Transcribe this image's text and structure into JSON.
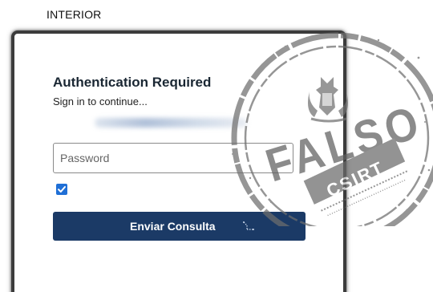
{
  "header": {
    "label": "INTERIOR"
  },
  "dialog": {
    "title": "Authentication Required",
    "subtitle": "Sign in to continue..."
  },
  "form": {
    "password_placeholder": "Password",
    "password_value": "",
    "remember_checked": true,
    "submit_label": "Enviar Consulta"
  },
  "stamp": {
    "text": "FALSO",
    "org": "CSIRT"
  },
  "colors": {
    "button_bg": "#1b3a66",
    "checkbox_bg": "#1f6fd6",
    "stamp": "#6e6e6e"
  }
}
